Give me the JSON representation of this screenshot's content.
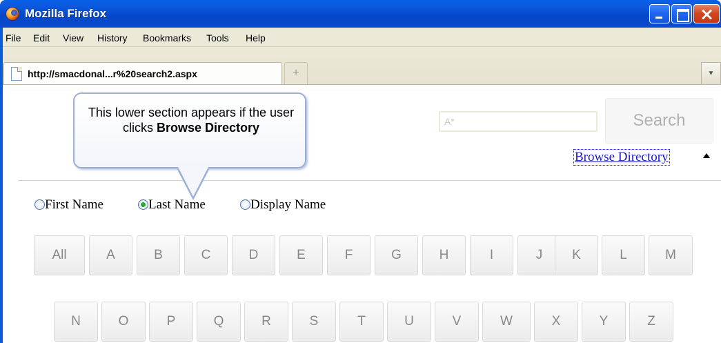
{
  "window": {
    "title": "Mozilla Firefox"
  },
  "menu": [
    "File",
    "Edit",
    "View",
    "History",
    "Bookmarks",
    "Tools",
    "Help"
  ],
  "tab": {
    "title": "http://smacdonal...r%20search2.aspx",
    "new_tab_symbol": "+"
  },
  "search": {
    "placeholder": "A*",
    "button_label": "Search"
  },
  "browse": {
    "link_label": "Browse Directory"
  },
  "callout": {
    "text_plain": "This lower section appears if the user clicks ",
    "text_bold": "Browse Directory"
  },
  "radios": [
    {
      "label": "First Name",
      "checked": false
    },
    {
      "label": "Last Name",
      "checked": true
    },
    {
      "label": "Display Name",
      "checked": false
    }
  ],
  "letters_row1": [
    "All",
    "A",
    "B",
    "C",
    "D",
    "E",
    "F",
    "G",
    "H",
    "I",
    "J",
    "K",
    "L",
    "M"
  ],
  "letters_row2": [
    "N",
    "O",
    "P",
    "Q",
    "R",
    "S",
    "T",
    "U",
    "V",
    "W",
    "X",
    "Y",
    "Z"
  ]
}
